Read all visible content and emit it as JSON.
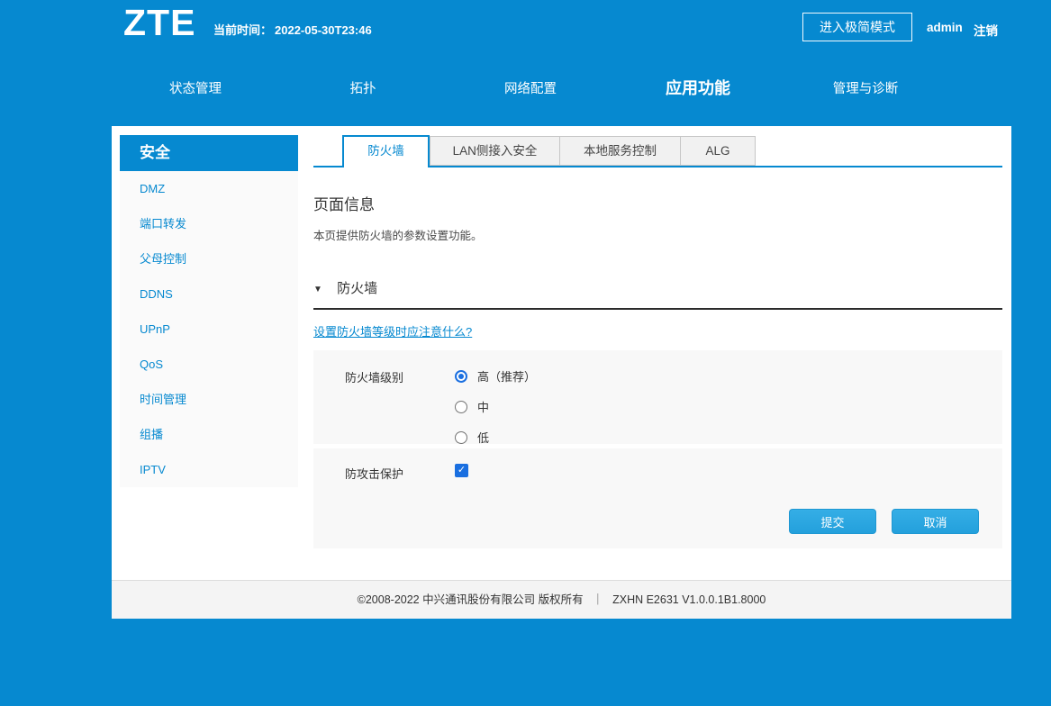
{
  "brand": {
    "logo": "ZTE"
  },
  "header": {
    "time_label": "当前时间：",
    "time_value": "2022-05-30T23:46",
    "simple_mode_button": "进入极简模式",
    "username": "admin",
    "logout": "注销"
  },
  "nav": {
    "items": [
      {
        "label": "状态管理",
        "active": false
      },
      {
        "label": "拓扑",
        "active": false
      },
      {
        "label": "网络配置",
        "active": false
      },
      {
        "label": "应用功能",
        "active": true
      },
      {
        "label": "管理与诊断",
        "active": false
      }
    ]
  },
  "sidebar": {
    "title": "安全",
    "items": [
      "DMZ",
      "端口转发",
      "父母控制",
      "DDNS",
      "UPnP",
      "QoS",
      "时间管理",
      "组播",
      "IPTV"
    ]
  },
  "tabs": [
    {
      "label": "防火墙",
      "active": true
    },
    {
      "label": "LAN侧接入安全",
      "active": false
    },
    {
      "label": "本地服务控制",
      "active": false
    },
    {
      "label": "ALG",
      "active": false
    }
  ],
  "page": {
    "info_title": "页面信息",
    "info_desc": "本页提供防火墙的参数设置功能。",
    "collapse_icon": "▼",
    "section_title": "防火墙",
    "help_link": "设置防火墙等级时应注意什么?",
    "firewall_level": {
      "label": "防火墙级别",
      "options": [
        {
          "label": "高（推荐）",
          "selected": true
        },
        {
          "label": "中",
          "selected": false
        },
        {
          "label": "低",
          "selected": false
        }
      ]
    },
    "attack_protection": {
      "label": "防攻击保护",
      "checked": true
    },
    "submit": "提交",
    "cancel": "取消"
  },
  "footer": {
    "copyright": "©2008-2022 中兴通讯股份有限公司 版权所有",
    "separator": "｜",
    "version": "ZXHN E2631 V1.0.0.1B1.8000"
  },
  "icons": {
    "check": "✓"
  },
  "colors": {
    "brand_blue": "#0689d0",
    "button_blue": "#2ba7e0",
    "control_blue": "#1a6fe0",
    "link_blue": "#0689d0",
    "footer_bg": "#f4f4f4",
    "block_bg": "#f8f8f8"
  }
}
